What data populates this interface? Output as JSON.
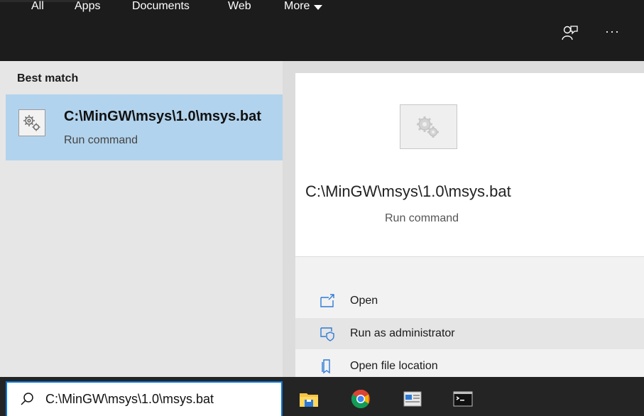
{
  "nav": {
    "all": "All",
    "apps": "Apps",
    "documents": "Documents",
    "web": "Web",
    "more": "More",
    "more_icon": "caret-down-icon",
    "feedback_icon": "feedback-icon",
    "options_label": "···"
  },
  "results": {
    "section_label": "Best match",
    "best": {
      "title": "C:\\MinGW\\msys\\1.0\\msys.bat",
      "subtitle": "Run command",
      "icon": "gears-icon"
    }
  },
  "preview": {
    "title": "C:\\MinGW\\msys\\1.0\\msys.bat",
    "subtitle": "Run command",
    "icon": "gears-icon",
    "actions": [
      {
        "label": "Open",
        "icon": "open-window-icon"
      },
      {
        "label": "Run as administrator",
        "icon": "shield-window-icon"
      },
      {
        "label": "Open file location",
        "icon": "file-location-icon"
      }
    ]
  },
  "search": {
    "value": "C:\\MinGW\\msys\\1.0\\msys.bat",
    "icon": "search-icon"
  },
  "taskbar": {
    "apps": [
      "file-explorer-icon",
      "chrome-icon",
      "app-window-icon",
      "command-prompt-icon"
    ]
  },
  "colors": {
    "nav_bg": "#1c1c1c",
    "selected_bg": "#b2d3ed",
    "accent": "#0a78d7",
    "action_icon": "#2d7ad6"
  }
}
